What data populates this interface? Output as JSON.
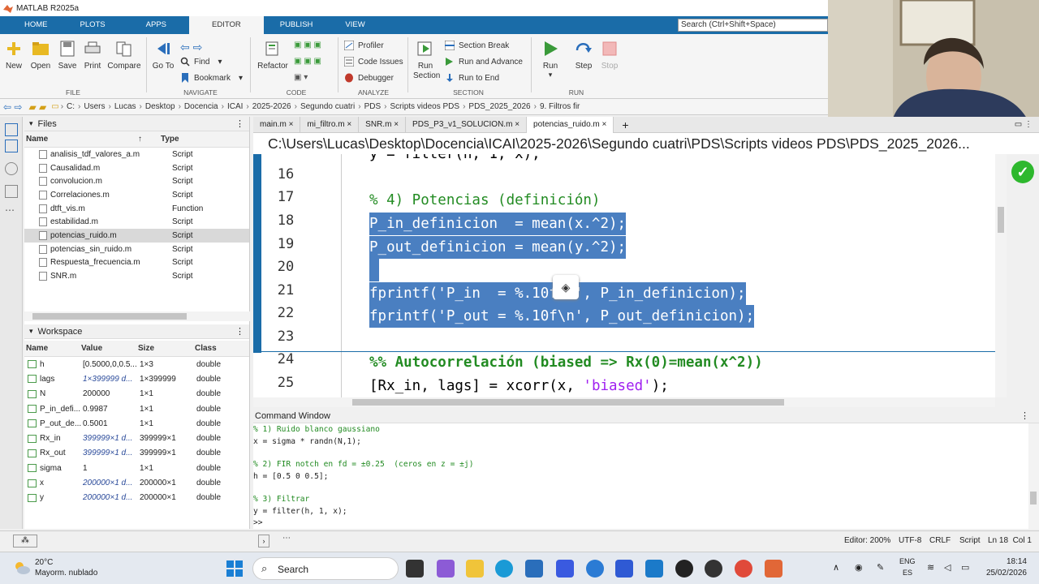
{
  "window": {
    "title": "MATLAB R2025a"
  },
  "tabs": [
    "HOME",
    "PLOTS",
    "APPS",
    "EDITOR",
    "PUBLISH",
    "VIEW"
  ],
  "search_placeholder": "Search (Ctrl+Shift+Space)",
  "ribbon": {
    "file": {
      "new": "New",
      "open": "Open",
      "save": "Save",
      "print": "Print",
      "compare": "Compare",
      "label": "FILE"
    },
    "navigate": {
      "goto": "Go To",
      "find": "Find",
      "bookmark": "Bookmark",
      "label": "NAVIGATE"
    },
    "code": {
      "refactor": "Refactor",
      "label": "CODE"
    },
    "analyze": {
      "profiler": "Profiler",
      "code_issues": "Code Issues",
      "debugger": "Debugger",
      "label": "ANALYZE"
    },
    "section": {
      "run_section": "Run Section",
      "section_break": "Section Break",
      "run_advance": "Run and Advance",
      "run_end": "Run to End",
      "label": "SECTION"
    },
    "run": {
      "run": "Run",
      "step": "Step",
      "stop": "Stop",
      "label": "RUN"
    }
  },
  "breadcrumb": [
    "C:",
    "Users",
    "Lucas",
    "Desktop",
    "Docencia",
    "ICAI",
    "2025-2026",
    "Segundo cuatri",
    "PDS",
    "Scripts videos PDS",
    "PDS_2025_2026",
    "9. Filtros fir"
  ],
  "files": {
    "title": "Files",
    "col_name": "Name",
    "col_type": "Type",
    "items": [
      {
        "name": "analisis_tdf_valores_a.m",
        "type": "Script"
      },
      {
        "name": "Causalidad.m",
        "type": "Script"
      },
      {
        "name": "convolucion.m",
        "type": "Script"
      },
      {
        "name": "Correlaciones.m",
        "type": "Script"
      },
      {
        "name": "dtft_vis.m",
        "type": "Function"
      },
      {
        "name": "estabilidad.m",
        "type": "Script"
      },
      {
        "name": "potencias_ruido.m",
        "type": "Script"
      },
      {
        "name": "potencias_sin_ruido.m",
        "type": "Script"
      },
      {
        "name": "Respuesta_frecuencia.m",
        "type": "Script"
      },
      {
        "name": "SNR.m",
        "type": "Script"
      }
    ]
  },
  "workspace": {
    "title": "Workspace",
    "cols": [
      "Name",
      "Value",
      "Size",
      "Class"
    ],
    "rows": [
      {
        "name": "h",
        "value": "[0.5000,0,0.5...",
        "size": "1×3",
        "class": "double"
      },
      {
        "name": "lags",
        "value": "1×399999 d...",
        "size": "1×399999",
        "class": "double"
      },
      {
        "name": "N",
        "value": "200000",
        "size": "1×1",
        "class": "double"
      },
      {
        "name": "P_in_defi...",
        "value": "0.9987",
        "size": "1×1",
        "class": "double"
      },
      {
        "name": "P_out_de...",
        "value": "0.5001",
        "size": "1×1",
        "class": "double"
      },
      {
        "name": "Rx_in",
        "value": "399999×1 d...",
        "size": "399999×1",
        "class": "double"
      },
      {
        "name": "Rx_out",
        "value": "399999×1 d...",
        "size": "399999×1",
        "class": "double"
      },
      {
        "name": "sigma",
        "value": "1",
        "size": "1×1",
        "class": "double"
      },
      {
        "name": "x",
        "value": "200000×1 d...",
        "size": "200000×1",
        "class": "double"
      },
      {
        "name": "y",
        "value": "200000×1 d...",
        "size": "200000×1",
        "class": "double"
      }
    ]
  },
  "editor": {
    "tabs": [
      "main.m",
      "mi_filtro.m",
      "SNR.m",
      "PDS_P3_v1_SOLUCION.m",
      "potencias_ruido.m"
    ],
    "path": "C:\\Users\\Lucas\\Desktop\\Docencia\\ICAI\\2025-2026\\Segundo cuatri\\PDS\\Scripts videos PDS\\PDS_2025_2026...",
    "line_numbers": [
      "16",
      "17",
      "18",
      "19",
      "20",
      "21",
      "22",
      "23",
      "24",
      "25"
    ],
    "partial_top": "y = filter(h, 1, x);",
    "l17": "% 4) Potencias (definición)",
    "l18": "P_in_definicion  = mean(x.^2);",
    "l19": "P_out_definicion = mean(y.^2);",
    "l21": "fprintf('P_in  = %.10f\\n', P_in_definicion);",
    "l22": "fprintf('P_out = %.10f\\n', P_out_definicion);",
    "l24": "%% Autocorrelación (biased => Rx(0)=mean(x^2))",
    "l25_a": "[Rx_in, lags] = xcorr(x, ",
    "l25_str": "'biased'",
    "l25_b": ");"
  },
  "command_window": {
    "title": "Command Window",
    "lines": [
      "% 1) Ruido blanco gaussiano",
      "x = sigma * randn(N,1);",
      "",
      "% 2) FIR notch en fd = ±0.25  (ceros en z = ±j)",
      "h = [0.5 0 0.5];",
      "",
      "% 3) Filtrar",
      "y = filter(h, 1, x);",
      ">>"
    ]
  },
  "status": {
    "zoom": "Editor: 200%",
    "encoding": "UTF-8",
    "eol": "CRLF",
    "type": "Script",
    "position": "Ln 18  Col 1"
  },
  "taskbar": {
    "weather_temp": "20°C",
    "weather_desc": "Mayorm. nublado",
    "search": "Search",
    "lang1": "ENG",
    "lang2": "ES",
    "time": "18:14",
    "date": "25/02/2026"
  }
}
